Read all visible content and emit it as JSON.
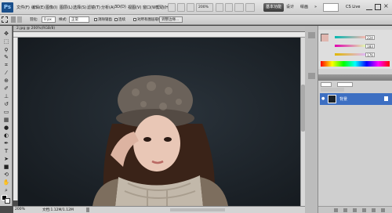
{
  "app": {
    "logo": "Ps"
  },
  "menu": [
    "文件(F)",
    "编辑(E)",
    "图像(I)",
    "图层(L)",
    "选择(S)",
    "滤镜(T)",
    "分析(A)",
    "3D(D)",
    "视图(V)",
    "窗口(W)",
    "帮助(H)"
  ],
  "menubar_tools": {
    "zoom": "200%"
  },
  "workspaces": {
    "active": "基本功能",
    "design": "设计",
    "painting": "绘画"
  },
  "cslive": "CS Live",
  "options": {
    "feather_label": "羽化:",
    "feather_value": "0 px",
    "mode_label": "样式:",
    "mode_value": "正常",
    "opt1": "消除锯齿",
    "opt2": "连续",
    "opt3": "对所有图层取样",
    "edge": "调整边缘..."
  },
  "document": {
    "tab": "2.jpg @ 200%(RGB/8)",
    "zoom": "200%",
    "status": "文档:1.12M/1.12M"
  },
  "color": {
    "r": "224",
    "g": "183",
    "b": "176",
    "swatch": "#e0b7b0"
  },
  "layers": {
    "layer_name": "背景"
  },
  "colors": {
    "selection": "#3d6fc2",
    "canvas": "#1c232a"
  }
}
